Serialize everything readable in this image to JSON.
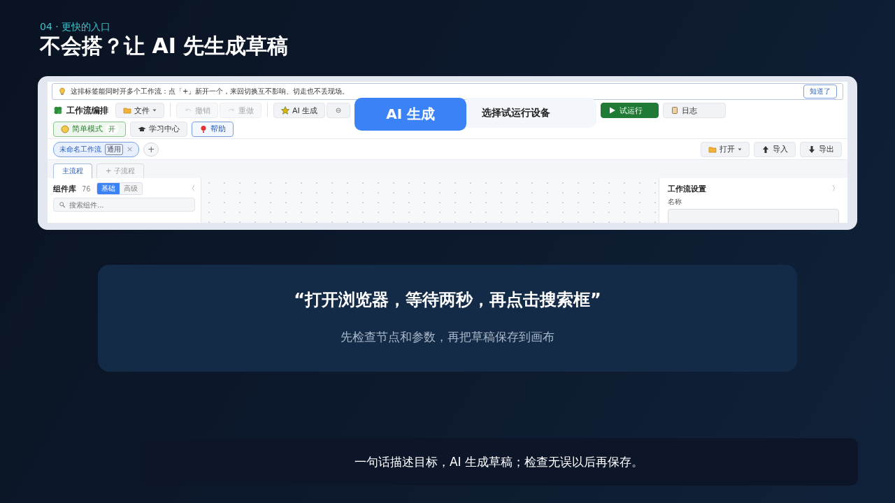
{
  "kicker": "04 · 更快的入口",
  "title": "不会搭？让 AI 先生成草稿",
  "app": {
    "tip": {
      "text": "这排标签能同时开多个工作流：点「+」新开一个，来回切换互不影响、切走也不丢现场。",
      "button": "知道了"
    },
    "brand": "工作流编排",
    "toolbar_groups": [
      [
        {
          "kind": "text",
          "label": "文件",
          "dropdown": true,
          "disabled": false
        }
      ],
      [
        {
          "kind": "text",
          "label": "撤销",
          "dropdown": false,
          "disabled": true
        },
        {
          "kind": "text",
          "label": "重做",
          "dropdown": false,
          "disabled": true
        }
      ],
      [
        {
          "kind": "text",
          "label": "AI 生成",
          "dropdown": false,
          "disabled": false
        },
        {
          "kind": "icon",
          "dropdown": false,
          "disabled": false
        }
      ]
    ],
    "callout": {
      "badge": "AI 生成",
      "caption": "选择试运行设备"
    },
    "actions": [
      {
        "label": "试运行",
        "kind": "solid-green"
      },
      {
        "label": "日志",
        "kind": "neutral"
      }
    ],
    "modes": [
      {
        "label": "简单模式",
        "toggle": "开",
        "kind": "green"
      },
      {
        "label": "学习中心",
        "kind": "neutral"
      },
      {
        "label": "帮助",
        "kind": "blue"
      }
    ],
    "workflow_tabs": [
      {
        "label": "未命名工作流",
        "badge": "通用",
        "close": "×",
        "selected": true
      }
    ],
    "add_tab": "+",
    "file_actions": [
      {
        "label": "打开",
        "dropdown": true
      },
      {
        "label": "导入",
        "dropdown": false
      },
      {
        "label": "导出",
        "dropdown": false
      }
    ],
    "flow_tabs": [
      {
        "label": "主流程",
        "selected": true
      },
      {
        "label": "+ 子流程",
        "selected": false
      }
    ],
    "library": {
      "title": "组件库",
      "count": "76",
      "tiers": [
        {
          "label": "基础",
          "selected": true
        },
        {
          "label": "高级",
          "selected": false
        }
      ],
      "collapse": "〈",
      "search_placeholder": "搜索组件..."
    },
    "settings": {
      "title": "工作流设置",
      "expand": "〉",
      "field_label": "名称"
    }
  },
  "quote": {
    "text": "“打开浏览器，等待两秒，再点击搜索框”",
    "note": "先检查节点和参数，再把草稿保存到画布"
  },
  "footer": "一句话描述目标，AI 生成草稿；检查无误以后再保存。"
}
